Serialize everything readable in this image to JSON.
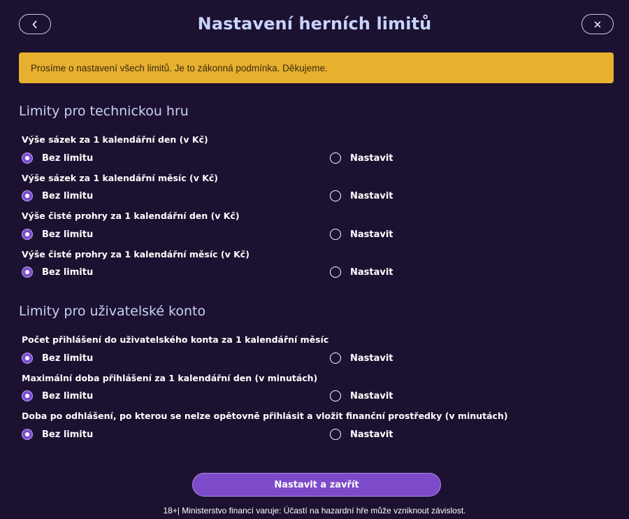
{
  "header": {
    "title": "Nastavení herních limitů",
    "back_icon": "chevron-left-icon",
    "close_icon": "close-icon"
  },
  "notice": {
    "text": "Prosíme o nastavení všech limitů. Je to zákonná podmínka. Děkujeme."
  },
  "sections": [
    {
      "title": "Limity pro technickou hru",
      "questions": [
        {
          "label": "Výše sázek za 1 kalendářní den (v Kč)",
          "options": [
            "Bez limitu",
            "Nastavit"
          ],
          "selected": "Bez limitu"
        },
        {
          "label": "Výše sázek za 1 kalendářní měsíc (v Kč)",
          "options": [
            "Bez limitu",
            "Nastavit"
          ],
          "selected": "Bez limitu"
        },
        {
          "label": "Výše čisté prohry za 1 kalendářní den (v Kč)",
          "options": [
            "Bez limitu",
            "Nastavit"
          ],
          "selected": "Bez limitu"
        },
        {
          "label": "Výše čisté prohry za 1 kalendářní měsíc (v Kč)",
          "options": [
            "Bez limitu",
            "Nastavit"
          ],
          "selected": "Bez limitu"
        }
      ]
    },
    {
      "title": "Limity pro uživatelské konto",
      "questions": [
        {
          "label": "Počet přihlášení do uživatelského konta za 1 kalendářní měsíc",
          "options": [
            "Bez limitu",
            "Nastavit"
          ],
          "selected": "Bez limitu"
        },
        {
          "label": "Maximální doba přihlášení za 1 kalendářní den (v minutách)",
          "options": [
            "Bez limitu",
            "Nastavit"
          ],
          "selected": "Bez limitu"
        },
        {
          "label": "Doba po odhlášení, po kterou se nelze opětovně přihlásit a vložit finanční prostředky (v minutách)",
          "options": [
            "Bez limitu",
            "Nastavit"
          ],
          "selected": "Bez limitu"
        }
      ]
    }
  ],
  "submit_label": "Nastavit a zavřít",
  "footer_warning": "18+| Ministerstvo financí varuje: Účastí na hazardní hře může vzniknout závislost.",
  "colors": {
    "background": "#1c1130",
    "notice": "#e7b02e",
    "accent": "#7d4bc9",
    "title": "#c7d3ff"
  }
}
